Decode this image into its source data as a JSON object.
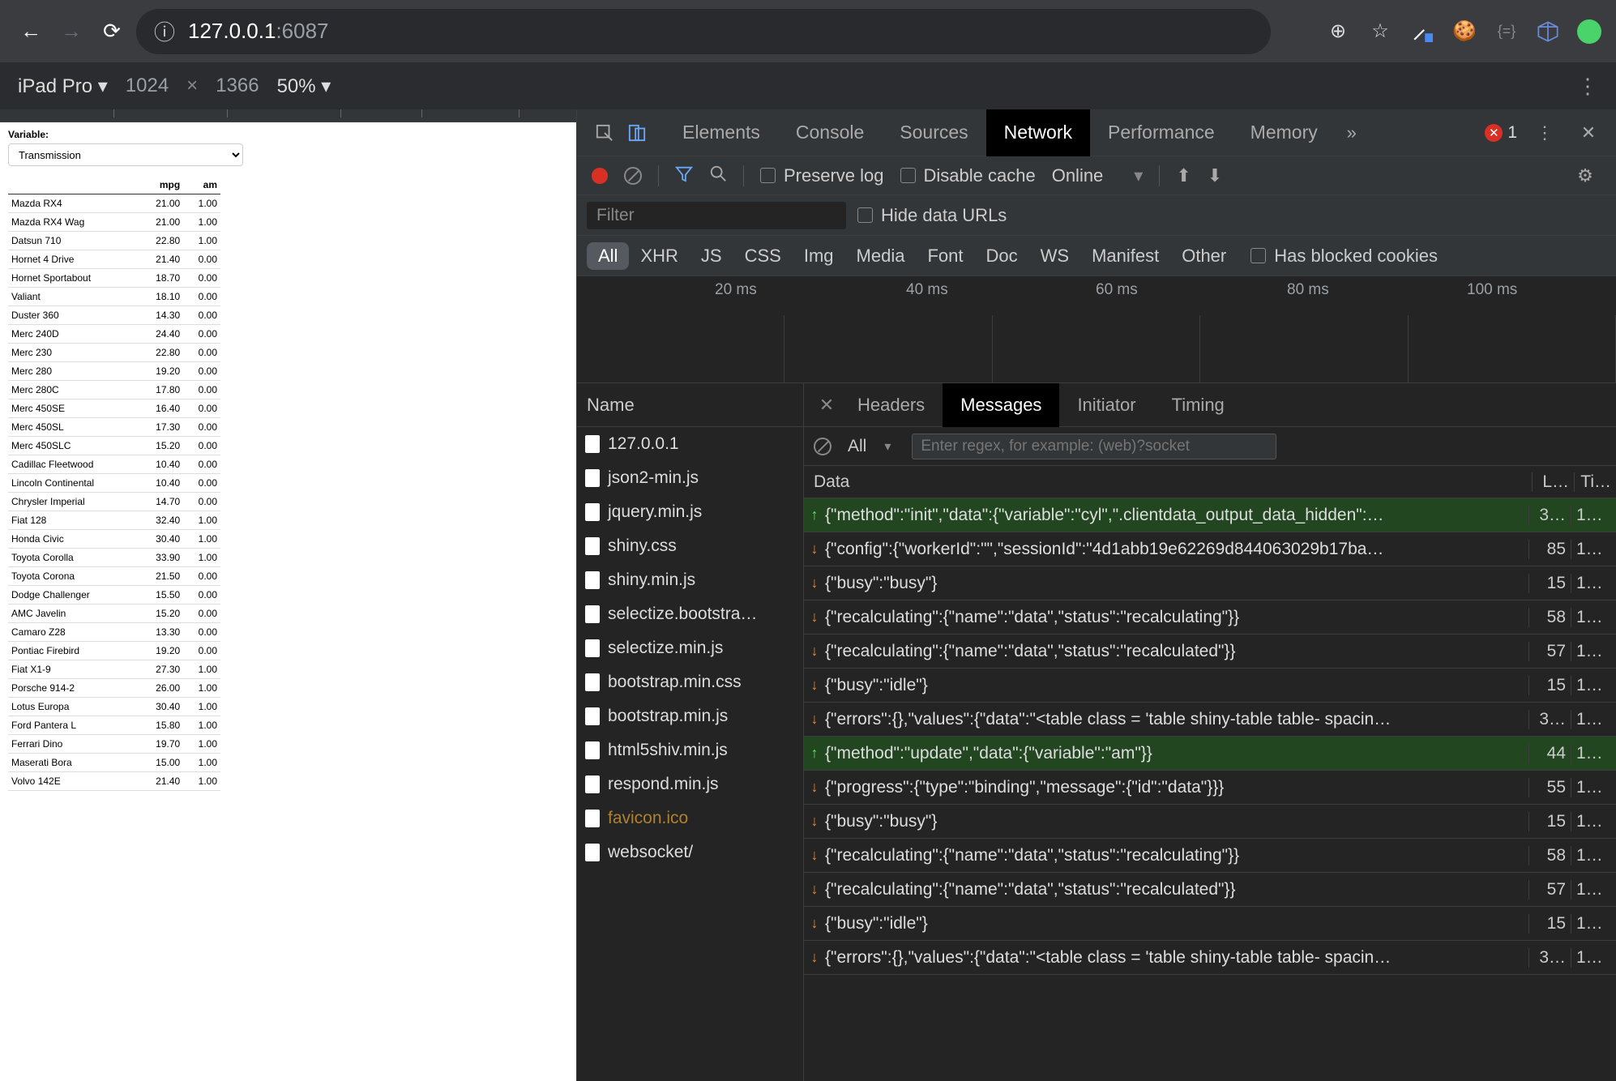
{
  "browser": {
    "url_host": "127.0.0.1",
    "url_port": ":6087"
  },
  "device_bar": {
    "device": "iPad Pro",
    "w": "1024",
    "h": "1366",
    "zoom": "50%"
  },
  "page": {
    "label": "Variable:",
    "select_value": "Transmission",
    "columns": [
      "",
      "mpg",
      "am"
    ],
    "rows": [
      [
        "Mazda RX4",
        "21.00",
        "1.00"
      ],
      [
        "Mazda RX4 Wag",
        "21.00",
        "1.00"
      ],
      [
        "Datsun 710",
        "22.80",
        "1.00"
      ],
      [
        "Hornet 4 Drive",
        "21.40",
        "0.00"
      ],
      [
        "Hornet Sportabout",
        "18.70",
        "0.00"
      ],
      [
        "Valiant",
        "18.10",
        "0.00"
      ],
      [
        "Duster 360",
        "14.30",
        "0.00"
      ],
      [
        "Merc 240D",
        "24.40",
        "0.00"
      ],
      [
        "Merc 230",
        "22.80",
        "0.00"
      ],
      [
        "Merc 280",
        "19.20",
        "0.00"
      ],
      [
        "Merc 280C",
        "17.80",
        "0.00"
      ],
      [
        "Merc 450SE",
        "16.40",
        "0.00"
      ],
      [
        "Merc 450SL",
        "17.30",
        "0.00"
      ],
      [
        "Merc 450SLC",
        "15.20",
        "0.00"
      ],
      [
        "Cadillac Fleetwood",
        "10.40",
        "0.00"
      ],
      [
        "Lincoln Continental",
        "10.40",
        "0.00"
      ],
      [
        "Chrysler Imperial",
        "14.70",
        "0.00"
      ],
      [
        "Fiat 128",
        "32.40",
        "1.00"
      ],
      [
        "Honda Civic",
        "30.40",
        "1.00"
      ],
      [
        "Toyota Corolla",
        "33.90",
        "1.00"
      ],
      [
        "Toyota Corona",
        "21.50",
        "0.00"
      ],
      [
        "Dodge Challenger",
        "15.50",
        "0.00"
      ],
      [
        "AMC Javelin",
        "15.20",
        "0.00"
      ],
      [
        "Camaro Z28",
        "13.30",
        "0.00"
      ],
      [
        "Pontiac Firebird",
        "19.20",
        "0.00"
      ],
      [
        "Fiat X1-9",
        "27.30",
        "1.00"
      ],
      [
        "Porsche 914-2",
        "26.00",
        "1.00"
      ],
      [
        "Lotus Europa",
        "30.40",
        "1.00"
      ],
      [
        "Ford Pantera L",
        "15.80",
        "1.00"
      ],
      [
        "Ferrari Dino",
        "19.70",
        "1.00"
      ],
      [
        "Maserati Bora",
        "15.00",
        "1.00"
      ],
      [
        "Volvo 142E",
        "21.40",
        "1.00"
      ]
    ]
  },
  "devtools": {
    "tabs": [
      "Elements",
      "Console",
      "Sources",
      "Network",
      "Performance",
      "Memory"
    ],
    "active_tab": "Network",
    "error_count": "1",
    "toolbar": {
      "preserve_log": "Preserve log",
      "disable_cache": "Disable cache",
      "throttling": "Online"
    },
    "filter_placeholder": "Filter",
    "hide_data_urls": "Hide data URLs",
    "types": [
      "All",
      "XHR",
      "JS",
      "CSS",
      "Img",
      "Media",
      "Font",
      "Doc",
      "WS",
      "Manifest",
      "Other"
    ],
    "blocked_cookies": "Has blocked cookies",
    "timeline_ticks": [
      "20 ms",
      "40 ms",
      "60 ms",
      "80 ms",
      "100 ms"
    ],
    "name_header": "Name",
    "files": [
      {
        "n": "127.0.0.1"
      },
      {
        "n": "json2-min.js"
      },
      {
        "n": "jquery.min.js"
      },
      {
        "n": "shiny.css"
      },
      {
        "n": "shiny.min.js"
      },
      {
        "n": "selectize.bootstra…"
      },
      {
        "n": "selectize.min.js"
      },
      {
        "n": "bootstrap.min.css"
      },
      {
        "n": "bootstrap.min.js"
      },
      {
        "n": "html5shiv.min.js"
      },
      {
        "n": "respond.min.js"
      },
      {
        "n": "favicon.ico",
        "warn": true
      },
      {
        "n": "websocket/"
      }
    ],
    "detail_tabs": [
      "Headers",
      "Messages",
      "Initiator",
      "Timing"
    ],
    "detail_active": "Messages",
    "msg_filter_all": "All",
    "msg_filter_placeholder": "Enter regex, for example: (web)?socket",
    "msg_headers": {
      "data": "Data",
      "len": "L…",
      "time": "Ti…"
    },
    "messages": [
      {
        "dir": "up",
        "txt": "{\"method\":\"init\",\"data\":{\"variable\":\"cyl\",\".clientdata_output_data_hidden\":…",
        "len": "3…",
        "time": "1…"
      },
      {
        "dir": "down",
        "txt": "{\"config\":{\"workerId\":\"\",\"sessionId\":\"4d1abb19e62269d844063029b17ba…",
        "len": "85",
        "time": "1…"
      },
      {
        "dir": "down",
        "txt": "{\"busy\":\"busy\"}",
        "len": "15",
        "time": "1…"
      },
      {
        "dir": "down",
        "txt": "{\"recalculating\":{\"name\":\"data\",\"status\":\"recalculating\"}}",
        "len": "58",
        "time": "1…"
      },
      {
        "dir": "down",
        "txt": "{\"recalculating\":{\"name\":\"data\",\"status\":\"recalculated\"}}",
        "len": "57",
        "time": "1…"
      },
      {
        "dir": "down",
        "txt": "{\"busy\":\"idle\"}",
        "len": "15",
        "time": "1…"
      },
      {
        "dir": "down",
        "txt": "{\"errors\":{},\"values\":{\"data\":\"<table class = 'table shiny-table table- spacin…",
        "len": "3…",
        "time": "1…"
      },
      {
        "dir": "up",
        "txt": "{\"method\":\"update\",\"data\":{\"variable\":\"am\"}}",
        "len": "44",
        "time": "1…"
      },
      {
        "dir": "down",
        "txt": "{\"progress\":{\"type\":\"binding\",\"message\":{\"id\":\"data\"}}}",
        "len": "55",
        "time": "1…"
      },
      {
        "dir": "down",
        "txt": "{\"busy\":\"busy\"}",
        "len": "15",
        "time": "1…"
      },
      {
        "dir": "down",
        "txt": "{\"recalculating\":{\"name\":\"data\",\"status\":\"recalculating\"}}",
        "len": "58",
        "time": "1…"
      },
      {
        "dir": "down",
        "txt": "{\"recalculating\":{\"name\":\"data\",\"status\":\"recalculated\"}}",
        "len": "57",
        "time": "1…"
      },
      {
        "dir": "down",
        "txt": "{\"busy\":\"idle\"}",
        "len": "15",
        "time": "1…"
      },
      {
        "dir": "down",
        "txt": "{\"errors\":{},\"values\":{\"data\":\"<table class = 'table shiny-table table- spacin…",
        "len": "3…",
        "time": "1…"
      }
    ]
  }
}
